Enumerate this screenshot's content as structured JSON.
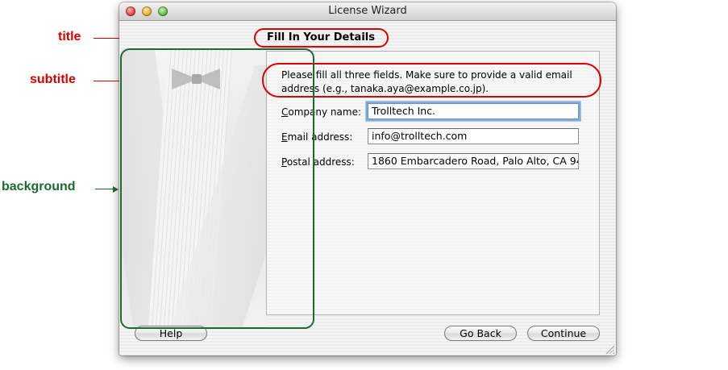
{
  "window": {
    "title": "License Wizard"
  },
  "page": {
    "title": "Fill In Your Details"
  },
  "subtitle": "Please fill all three fields. Make sure to provide a valid email address (e.g., tanaka.aya@example.co.jp).",
  "fields": {
    "company": {
      "mnemonic": "C",
      "label": "ompany name:",
      "value": "Trolltech Inc."
    },
    "email": {
      "mnemonic": "E",
      "label": "mail address:",
      "value": "info@trolltech.com"
    },
    "postal": {
      "mnemonic": "P",
      "label": "ostal address:",
      "value": "1860 Embarcadero Road, Palo Alto, CA 94"
    }
  },
  "buttons": {
    "help": "Help",
    "back": "Go Back",
    "continue": "Continue"
  },
  "annotations": {
    "title": {
      "text": "title",
      "color": "#dd0000"
    },
    "subtitle": {
      "text": "subtitle",
      "color": "#dd0000"
    },
    "background": {
      "text": "background",
      "color": "#1c6a2e"
    }
  }
}
